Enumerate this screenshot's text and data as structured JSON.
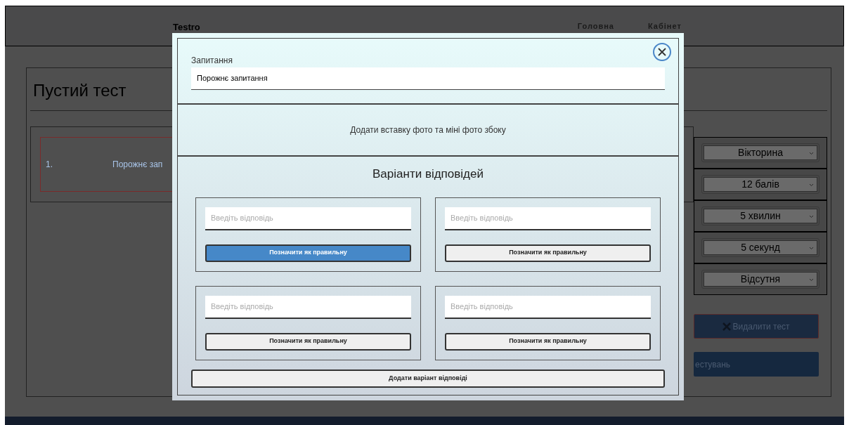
{
  "header": {
    "logo": "Testro",
    "nav": [
      {
        "label": "Головна"
      },
      {
        "label": "Кабінет"
      }
    ]
  },
  "test": {
    "title": "Пустий тест",
    "questions": [
      {
        "number": "1.",
        "text": "Порожнє зап"
      }
    ],
    "settings": [
      {
        "value": "Вікторина"
      },
      {
        "value": "12 балів"
      },
      {
        "value": "5 хвилин"
      },
      {
        "value": "5 секунд"
      },
      {
        "value": "Відсутня"
      }
    ],
    "delete_button": "Видалити тест",
    "second_button": "естувань"
  },
  "modal": {
    "question_label": "Запитання",
    "question_value": "Порожнє запитання",
    "photo_text": "Додати вставку фото та міні фото збоку",
    "answers_title": "Варіанти відповідей",
    "answers": [
      {
        "placeholder": "Введіть відповідь",
        "button": "Позначити як правильну",
        "selected": true
      },
      {
        "placeholder": "Введіть відповідь",
        "button": "Позначити як правильну",
        "selected": false
      },
      {
        "placeholder": "Введіть відповідь",
        "button": "Позначити як правильну",
        "selected": false
      },
      {
        "placeholder": "Введіть відповідь",
        "button": "Позначити як правильну",
        "selected": false
      }
    ],
    "add_button": "Додати варіант відповіді"
  }
}
